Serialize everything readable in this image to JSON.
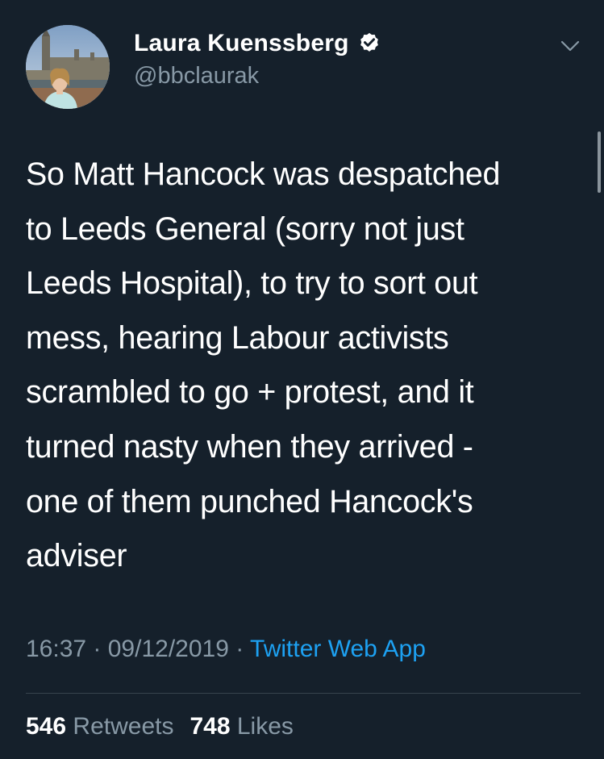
{
  "author": {
    "display_name": "Laura Kuenssberg",
    "handle": "@bbclaurak",
    "verified": true
  },
  "tweet": {
    "text": "So Matt Hancock was despatched\nto Leeds General (sorry not just\nLeeds Hospital), to try to sort out\nmess, hearing Labour activists\nscrambled to go + protest, and it\nturned nasty when they arrived -\none of them punched Hancock's\nadviser",
    "time": "16:37",
    "separator": " · ",
    "date": "09/12/2019",
    "source": "Twitter Web App"
  },
  "stats": {
    "retweets_count": "546",
    "retweets_label": "Retweets",
    "likes_count": "748",
    "likes_label": "Likes"
  },
  "icons": {
    "verified": "verified-badge-icon",
    "menu": "chevron-down-icon"
  },
  "colors": {
    "background": "#15202b",
    "text": "#ffffff",
    "secondary": "#8899a6",
    "link": "#1da1f2",
    "divider": "#38444d"
  }
}
